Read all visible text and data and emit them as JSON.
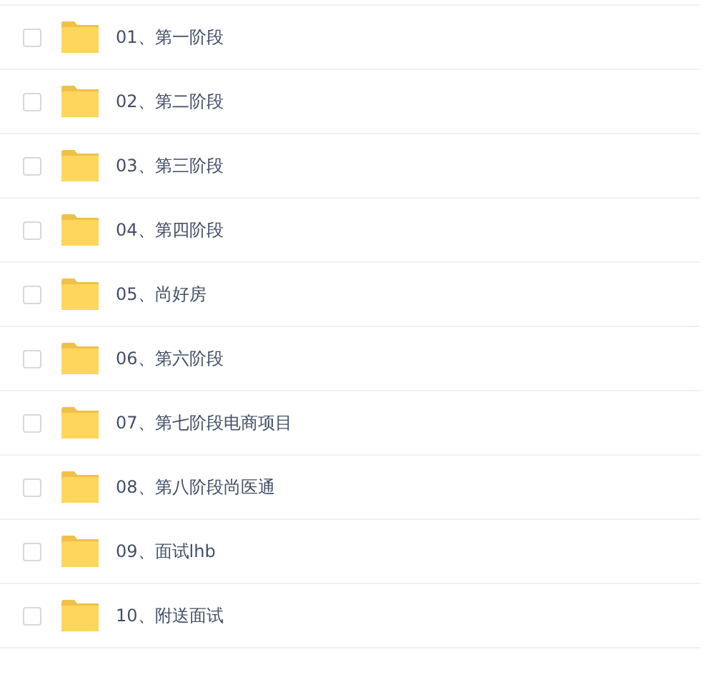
{
  "files": [
    {
      "name": "01、第一阶段",
      "checked": false
    },
    {
      "name": "02、第二阶段",
      "checked": false
    },
    {
      "name": "03、第三阶段",
      "checked": false
    },
    {
      "name": "04、第四阶段",
      "checked": false
    },
    {
      "name": "05、尚好房",
      "checked": false
    },
    {
      "name": "06、第六阶段",
      "checked": false
    },
    {
      "name": "07、第七阶段电商项目",
      "checked": false
    },
    {
      "name": "08、第八阶段尚医通",
      "checked": false
    },
    {
      "name": "09、面试lhb",
      "checked": false
    },
    {
      "name": "10、附送面试",
      "checked": false
    }
  ]
}
